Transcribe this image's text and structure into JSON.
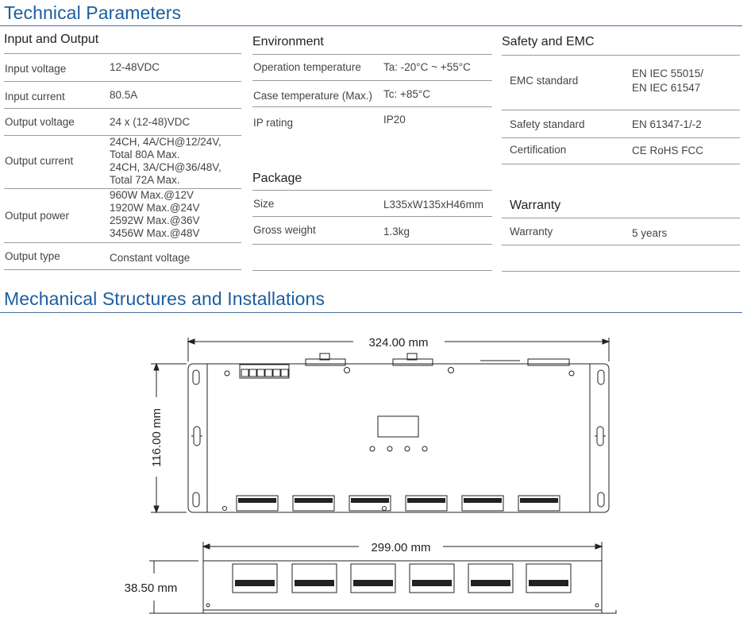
{
  "titles": {
    "technical": "Technical Parameters",
    "mechanical": "Mechanical Structures and Installations"
  },
  "input_output": {
    "title": "Input and Output",
    "rows": [
      {
        "label": "Input voltage",
        "value": [
          "12-48VDC"
        ]
      },
      {
        "label": "Input current",
        "value": [
          "80.5A"
        ]
      },
      {
        "label": "Output voltage",
        "value": [
          "24 x (12-48)VDC"
        ]
      },
      {
        "label": "Output current",
        "value": [
          "24CH, 4A/CH@12/24V,",
          "Total 80A Max.",
          "24CH, 3A/CH@36/48V,",
          "Total 72A Max."
        ]
      },
      {
        "label": "Output power",
        "value": [
          "960W Max.@12V",
          "1920W Max.@24V",
          "2592W Max.@36V",
          "3456W Max.@48V"
        ]
      },
      {
        "label": "Output type",
        "value": [
          "Constant voltage"
        ]
      }
    ]
  },
  "environment": {
    "title": "Environment",
    "rows": [
      {
        "label": "Operation temperature",
        "value": "Ta: -20°C ~ +55°C"
      },
      {
        "label": "Case temperature (Max.)",
        "value": "Tc: +85°C"
      },
      {
        "label": "IP rating",
        "value": "IP20"
      }
    ]
  },
  "package": {
    "title": "Package",
    "rows": [
      {
        "label": "Size",
        "value": "L335xW135xH46mm"
      },
      {
        "label": "Gross weight",
        "value": "1.3kg"
      }
    ]
  },
  "safety": {
    "title": "Safety and EMC",
    "rows": [
      {
        "label": "EMC standard",
        "value": [
          "EN IEC 55015/",
          "EN IEC 61547"
        ]
      },
      {
        "label": "Safety standard",
        "value": [
          "EN 61347-1/-2"
        ]
      },
      {
        "label": "Certification",
        "value": [
          "CE RoHS FCC"
        ]
      }
    ]
  },
  "warranty": {
    "title": "Warranty",
    "rows": [
      {
        "label": "Warranty",
        "value": "5 years"
      }
    ]
  },
  "drawing": {
    "top_width": "324.00 mm",
    "top_height": "116.00 mm",
    "side_width": "299.00 mm",
    "side_height": "38.50 mm"
  }
}
